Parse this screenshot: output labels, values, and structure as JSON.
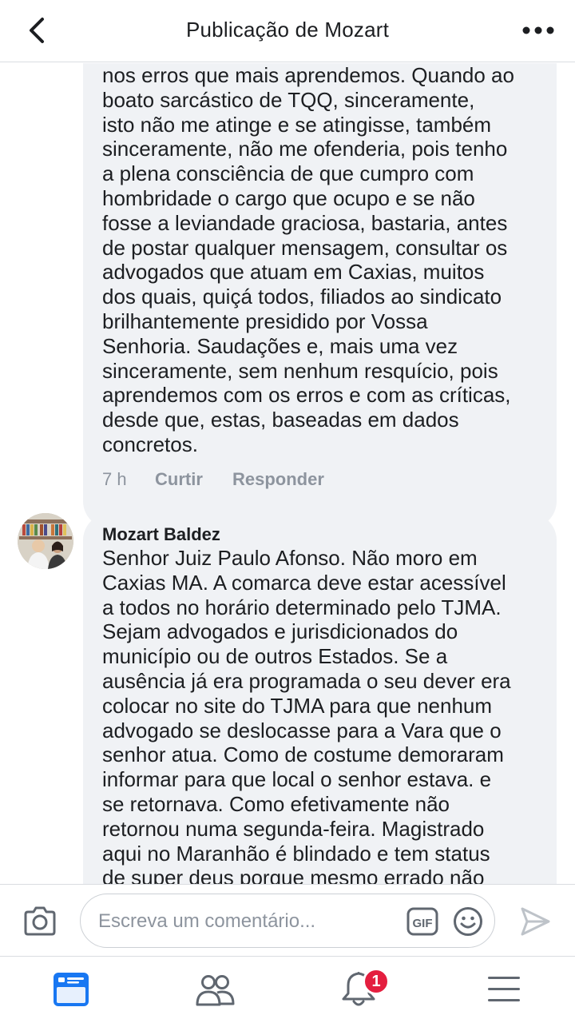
{
  "header": {
    "title": "Publicação de Mozart"
  },
  "comment_1": {
    "lines": [
      "nos erros que mais aprendemos. Quando ao",
      "boato  sarcástico de TQQ,  sinceramente,",
      "isto não me  atinge e se atingisse, também",
      "sinceramente, não me ofenderia, pois tenho",
      "a plena consciência de que cumpro com",
      "hombridade o cargo que ocupo e se não",
      "fosse a leviandade graciosa, bastaria, antes",
      "de postar qualquer mensagem, consultar os",
      "advogados que atuam em Caxias, muitos",
      "dos quais, quiçá  todos, filiados ao sindicato",
      "brilhantemente presidido por Vossa",
      "Senhoria. Saudações e, mais uma vez",
      "sinceramente, sem nenhum resquício, pois",
      "aprendemos com os erros e com as críticas,",
      "desde que, estas, baseadas em dados",
      "concretos."
    ],
    "time": "7 h",
    "like_label": "Curtir",
    "reply_label": "Responder"
  },
  "comment_2": {
    "author": "Mozart Baldez",
    "lines": [
      "Senhor Juiz Paulo Afonso. Não moro em",
      "Caxias MA.  A comarca deve estar acessível",
      "a todos no horário  determinado pelo TJMA.",
      "Sejam  advogados e jurisdicionados  do",
      "município  ou de outros Estados. Se a",
      "ausência já era programada o seu dever era",
      "colocar no site do TJMA para que nenhum",
      "advogado se deslocasse para a Vara que o",
      "senhor atua. Como de costume demoraram",
      "informar para que local o senhor estava. e",
      "se retornava. Como efetivamente  não",
      "retornou numa segunda-feira.  Magistrado",
      "aqui no Maranhão  é  blindado e tem status",
      "de super deus porque mesmo errado não"
    ]
  },
  "composer": {
    "placeholder": "Escreva um comentário...",
    "gif_label": "GIF"
  },
  "tabbar": {
    "notification_count": "1"
  },
  "colors": {
    "accent": "#1877f2",
    "icon_gray": "#606770",
    "bubble_bg": "#f0f2f5",
    "badge_red": "#e41e3f"
  },
  "icons": {
    "back": "chevron-left-icon",
    "more": "more-dots-icon",
    "camera": "camera-icon",
    "gif": "gif-icon",
    "emoji": "emoji-icon",
    "send": "send-icon",
    "feed": "news-feed-icon",
    "friends": "friends-icon",
    "notifications": "bell-icon",
    "menu": "hamburger-menu-icon"
  }
}
